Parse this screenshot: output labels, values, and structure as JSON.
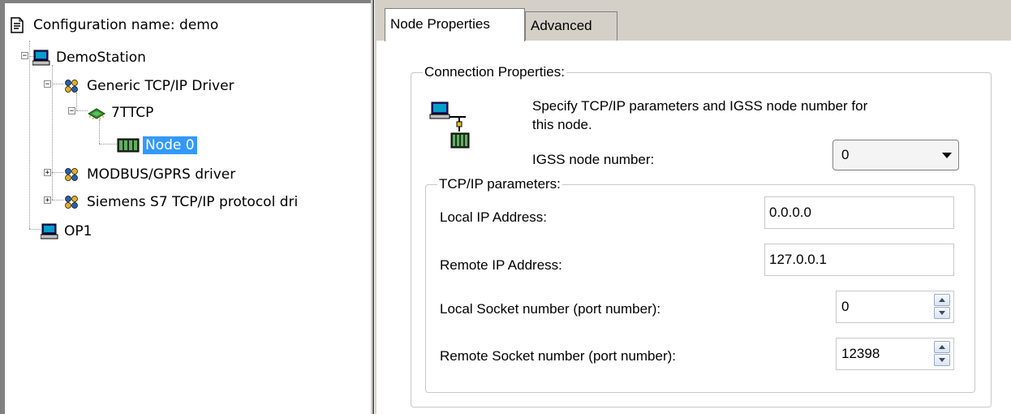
{
  "tree": {
    "root_label": "Configuration name: demo",
    "items": [
      {
        "label": "DemoStation",
        "icon": "computer-icon",
        "expander": "−"
      },
      {
        "label": "Generic TCP/IP Driver",
        "icon": "driver-icon",
        "expander": "−"
      },
      {
        "label": "7TTCP",
        "icon": "network-card-icon",
        "expander": "−"
      },
      {
        "label": "Node 0",
        "icon": "plc-rack-icon",
        "selected": true
      },
      {
        "label": "MODBUS/GPRS driver",
        "icon": "driver-icon",
        "expander": "+"
      },
      {
        "label": "Siemens S7 TCP/IP protocol dri",
        "icon": "driver-icon",
        "expander": "+"
      },
      {
        "label": "OP1",
        "icon": "computer-icon"
      }
    ]
  },
  "tabs": [
    {
      "label": "Node Properties",
      "active": true
    },
    {
      "label": "Advanced",
      "active": false
    }
  ],
  "connection": {
    "legend": "Connection Properties:",
    "description_line1": "Specify TCP/IP parameters and IGSS node number for",
    "description_line2": "this node.",
    "igss_label": "IGSS node number:",
    "igss_value": "0"
  },
  "tcpip": {
    "legend": "TCP/IP parameters:",
    "local_ip_label": "Local IP Address:",
    "local_ip_value": "0.0.0.0",
    "remote_ip_label": "Remote IP Address:",
    "remote_ip_value": "127.0.0.1",
    "local_socket_label": "Local Socket number (port number):",
    "local_socket_value": "0",
    "remote_socket_label": "Remote Socket number (port number):",
    "remote_socket_value": "12398"
  },
  "colors": {
    "selection": "#3399ff",
    "panel": "#d4d0c8",
    "border": "#808080"
  }
}
